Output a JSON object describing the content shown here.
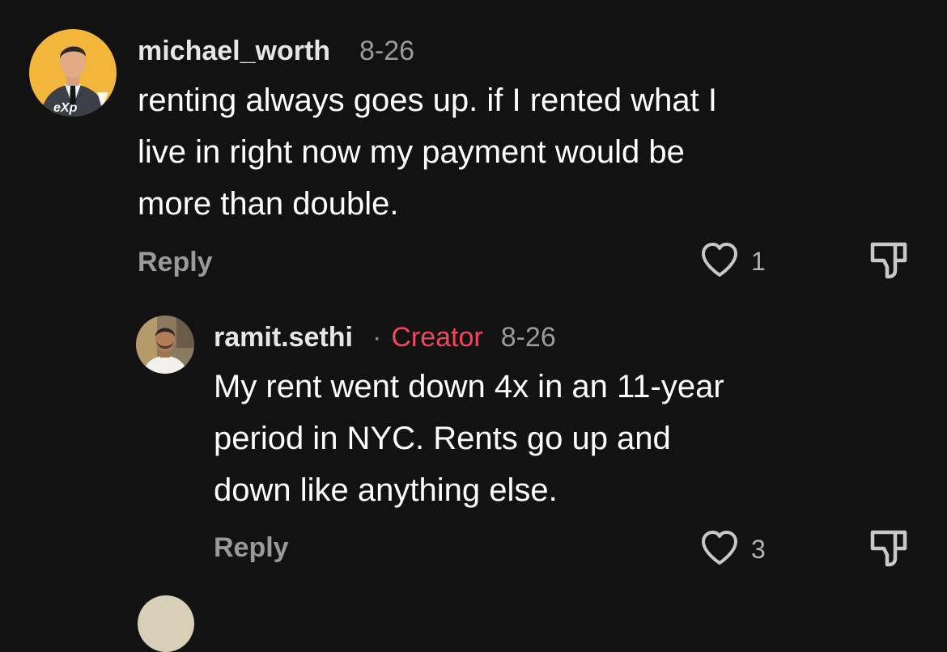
{
  "comments": [
    {
      "username": "michael_worth",
      "date": "8-26",
      "text_lines": [
        "renting always goes up. if I rented what I",
        "live in right now my payment would be",
        "more than double."
      ],
      "reply_label": "Reply",
      "like_count": "1",
      "avatar_text": "eXp",
      "avatar_bg": "#f2b63a"
    },
    {
      "username": "ramit.sethi",
      "badge": "Creator",
      "separator": "·",
      "date": "8-26",
      "text_lines": [
        "My rent went down 4x in an 11-year",
        "period in NYC. Rents go up and",
        "down like anything else."
      ],
      "reply_label": "Reply",
      "like_count": "3"
    }
  ],
  "colors": {
    "background": "#121212",
    "creator_badge": "#f0475f",
    "muted_text": "#9a9a9a"
  },
  "icons": {
    "like": "heart-outline-icon",
    "dislike": "thumbs-down-outline-icon"
  }
}
